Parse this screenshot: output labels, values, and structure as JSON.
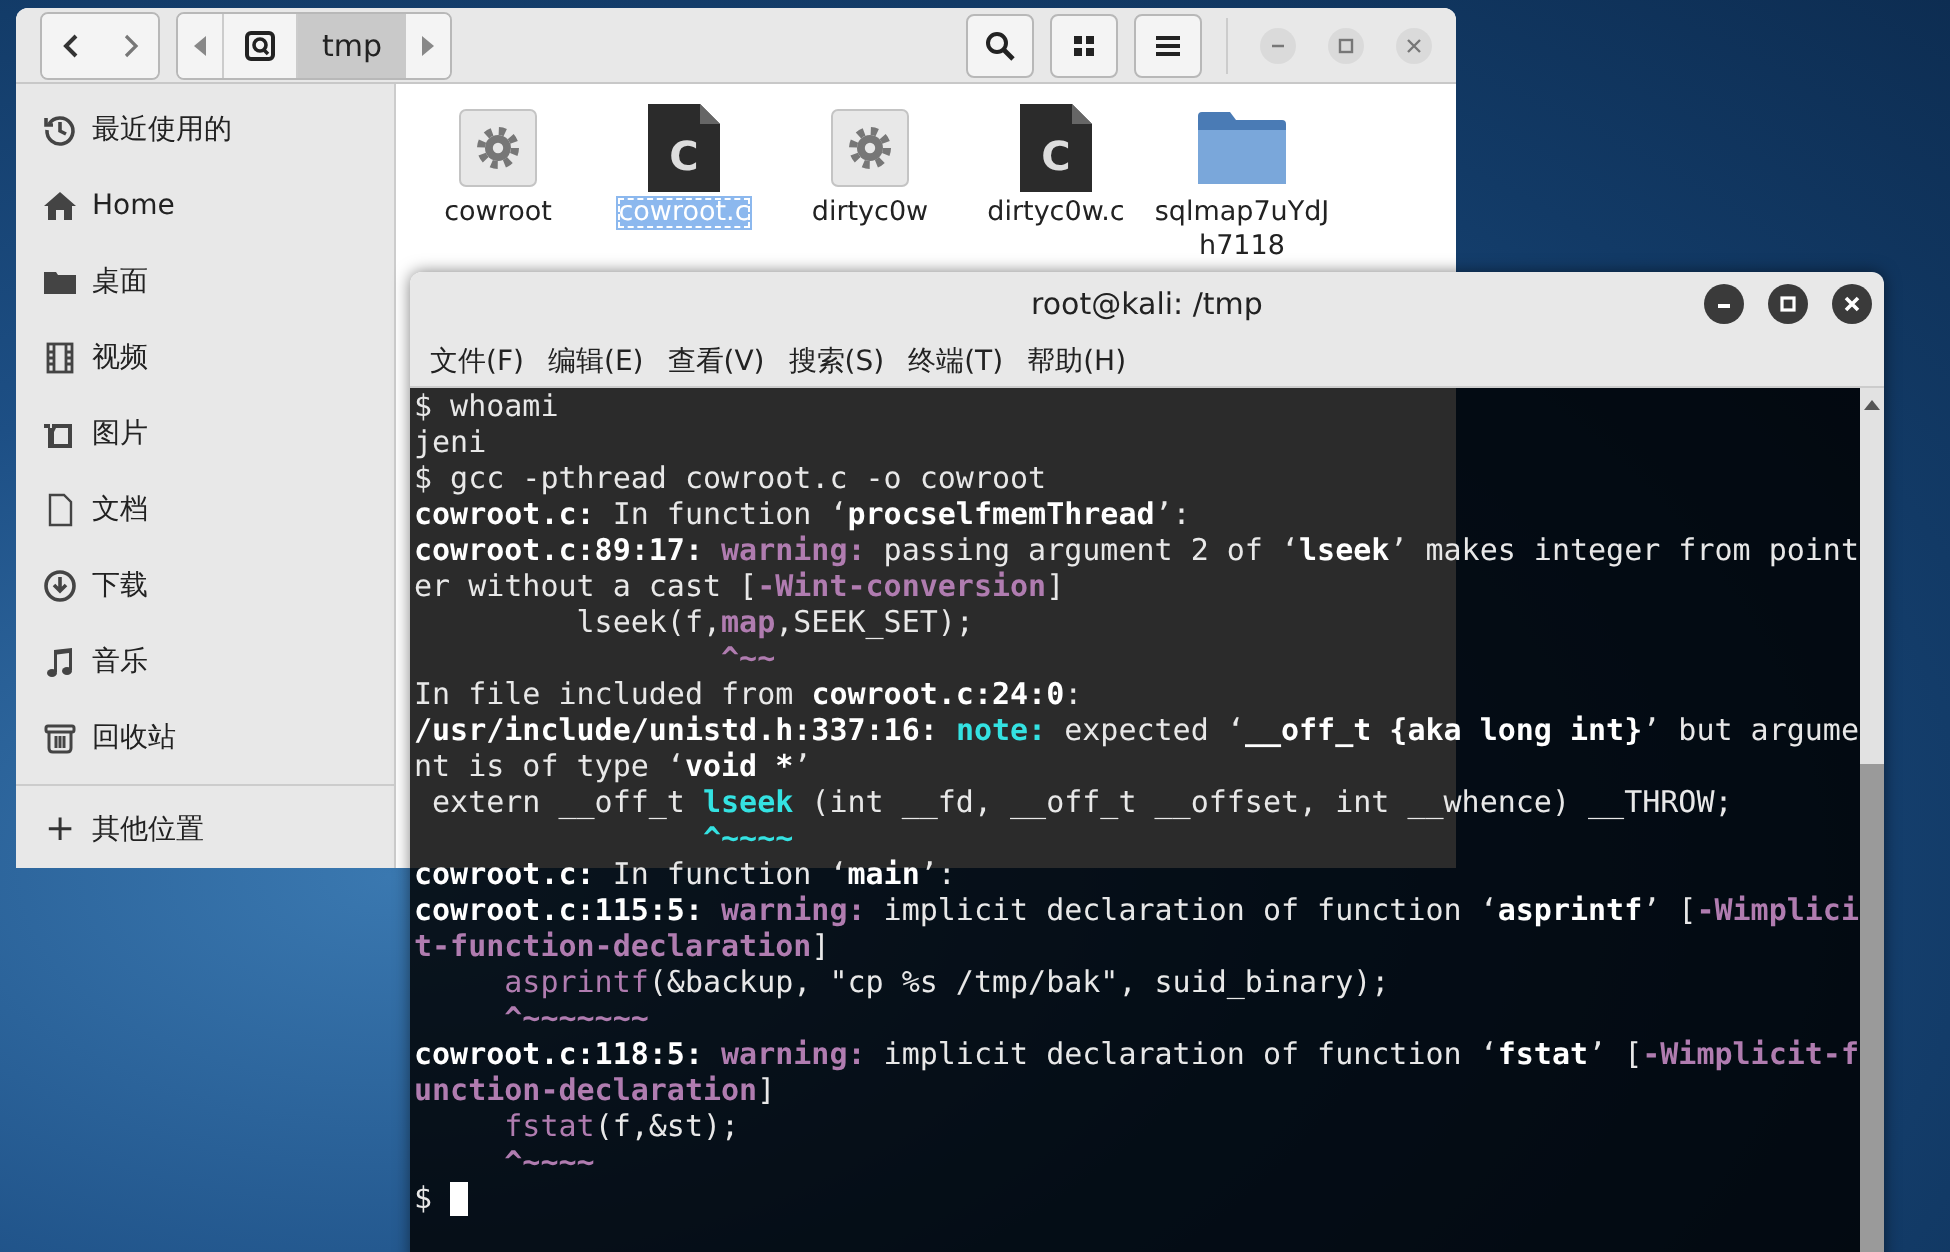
{
  "file_manager": {
    "path": [
      {
        "kind": "root",
        "selected": false
      },
      {
        "kind": "folder",
        "label": "tmp",
        "selected": true
      }
    ],
    "sidebar": [
      {
        "kind": "recent",
        "label": "最近使用的"
      },
      {
        "kind": "home",
        "label": "Home"
      },
      {
        "kind": "desktop",
        "label": "桌面"
      },
      {
        "kind": "video",
        "label": "视频"
      },
      {
        "kind": "pictures",
        "label": "图片"
      },
      {
        "kind": "documents",
        "label": "文档"
      },
      {
        "kind": "downloads",
        "label": "下载"
      },
      {
        "kind": "music",
        "label": "音乐"
      },
      {
        "kind": "trash",
        "label": "回收站"
      }
    ],
    "other_locations": {
      "symbol": "+",
      "label": "其他位置"
    },
    "files": [
      {
        "kind": "executable",
        "name": "cowroot",
        "selected": false
      },
      {
        "kind": "c-source",
        "icon_letter": "C",
        "name": "cowroot.c",
        "selected": true
      },
      {
        "kind": "executable",
        "name": "dirtyc0w",
        "selected": false
      },
      {
        "kind": "c-source",
        "icon_letter": "C",
        "name": "dirtyc0w.c",
        "selected": false
      },
      {
        "kind": "folder",
        "name": "sqlmap7uYdJh7118",
        "selected": false
      }
    ]
  },
  "terminal": {
    "title": "root@kali: /tmp",
    "menu": [
      "文件(F)",
      "编辑(E)",
      "查看(V)",
      "搜索(S)",
      "终端(T)",
      "帮助(H)"
    ],
    "lines": [
      [
        {
          "kind": "plain",
          "text": "$ whoami"
        }
      ],
      [
        {
          "kind": "plain",
          "text": "jeni"
        }
      ],
      [
        {
          "kind": "plain",
          "text": "$ gcc -pthread cowroot.c -o cowroot"
        }
      ],
      [
        {
          "kind": "bold",
          "text": "cowroot.c:"
        },
        {
          "kind": "plain",
          "text": " In function ‘"
        },
        {
          "kind": "bold",
          "text": "procselfmemThread"
        },
        {
          "kind": "plain",
          "text": "’:"
        }
      ],
      [
        {
          "kind": "bold",
          "text": "cowroot.c:89:17: "
        },
        {
          "kind": "magenta",
          "text": "warning:"
        },
        {
          "kind": "plain",
          "text": " passing argument 2 of ‘"
        },
        {
          "kind": "bold",
          "text": "lseek"
        },
        {
          "kind": "plain",
          "text": "’ makes integer from point"
        }
      ],
      [
        {
          "kind": "plain",
          "text": "er without a cast ["
        },
        {
          "kind": "magenta",
          "text": "-Wint-conversion"
        },
        {
          "kind": "plain",
          "text": "]"
        }
      ],
      [
        {
          "kind": "plain",
          "text": "         lseek(f,"
        },
        {
          "kind": "magenta",
          "text": "map"
        },
        {
          "kind": "plain",
          "text": ",SEEK_SET);"
        }
      ],
      [
        {
          "kind": "magenta",
          "text": "                 ^~~"
        }
      ],
      [
        {
          "kind": "plain",
          "text": "In file included from "
        },
        {
          "kind": "bold",
          "text": "cowroot.c:24:0"
        },
        {
          "kind": "plain",
          "text": ":"
        }
      ],
      [
        {
          "kind": "bold",
          "text": "/usr/include/unistd.h:337:16: "
        },
        {
          "kind": "cyan",
          "text": "note:"
        },
        {
          "kind": "plain",
          "text": " expected ‘"
        },
        {
          "kind": "bold",
          "text": "__off_t {aka long int}"
        },
        {
          "kind": "plain",
          "text": "’ but argume"
        }
      ],
      [
        {
          "kind": "plain",
          "text": "nt is of type ‘"
        },
        {
          "kind": "bold",
          "text": "void *"
        },
        {
          "kind": "plain",
          "text": "’"
        }
      ],
      [
        {
          "kind": "plain",
          "text": " extern __off_t "
        },
        {
          "kind": "cyan",
          "text": "lseek"
        },
        {
          "kind": "plain",
          "text": " (int __fd, __off_t __offset, int __whence) __THROW;"
        }
      ],
      [
        {
          "kind": "cyan",
          "text": "                ^~~~~"
        }
      ],
      [
        {
          "kind": "bold",
          "text": "cowroot.c:"
        },
        {
          "kind": "plain",
          "text": " In function ‘"
        },
        {
          "kind": "bold",
          "text": "main"
        },
        {
          "kind": "plain",
          "text": "’:"
        }
      ],
      [
        {
          "kind": "bold",
          "text": "cowroot.c:115:5: "
        },
        {
          "kind": "magenta",
          "text": "warning:"
        },
        {
          "kind": "plain",
          "text": " implicit declaration of function ‘"
        },
        {
          "kind": "bold",
          "text": "asprintf"
        },
        {
          "kind": "plain",
          "text": "’ ["
        },
        {
          "kind": "magenta",
          "text": "-Wimplici"
        }
      ],
      [
        {
          "kind": "magenta",
          "text": "t-function-declaration"
        },
        {
          "kind": "plain",
          "text": "]"
        }
      ],
      [
        {
          "kind": "magenta-plain",
          "text": "     asprintf"
        },
        {
          "kind": "plain",
          "text": "(&backup, \"cp %s /tmp/bak\", suid_binary);"
        }
      ],
      [
        {
          "kind": "magenta",
          "text": "     ^~~~~~~~"
        }
      ],
      [
        {
          "kind": "bold",
          "text": "cowroot.c:118:5: "
        },
        {
          "kind": "magenta",
          "text": "warning:"
        },
        {
          "kind": "plain",
          "text": " implicit declaration of function ‘"
        },
        {
          "kind": "bold",
          "text": "fstat"
        },
        {
          "kind": "plain",
          "text": "’ ["
        },
        {
          "kind": "magenta",
          "text": "-Wimplicit-f"
        }
      ],
      [
        {
          "kind": "magenta",
          "text": "unction-declaration"
        },
        {
          "kind": "plain",
          "text": "]"
        }
      ],
      [
        {
          "kind": "magenta-plain",
          "text": "     fstat"
        },
        {
          "kind": "plain",
          "text": "(f,&st);"
        }
      ],
      [
        {
          "kind": "magenta",
          "text": "     ^~~~~"
        }
      ]
    ],
    "prompt": "$ ",
    "cursor_visible": true
  }
}
